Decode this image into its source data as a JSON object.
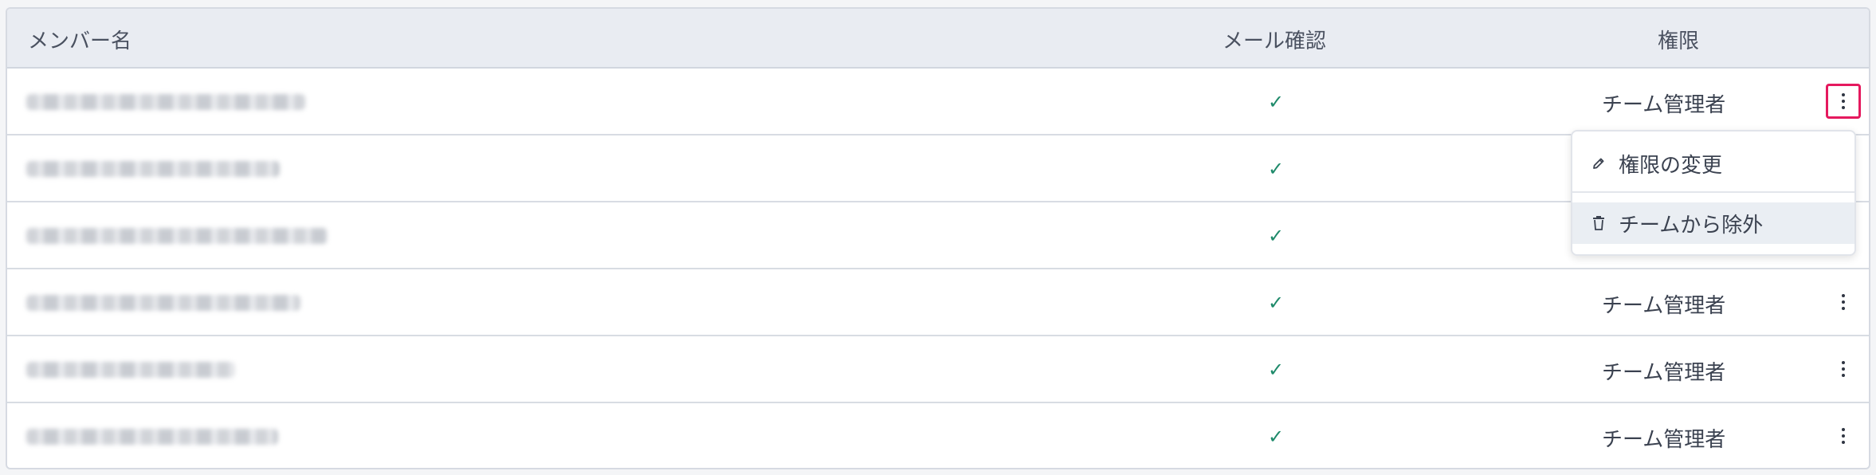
{
  "table": {
    "headers": {
      "member_name": "メンバー名",
      "email_confirmed": "メール確認",
      "permission": "権限"
    },
    "rows": [
      {
        "email_confirmed_icon": "check-icon",
        "check": "✓",
        "role": "チーム管理者",
        "menu_open": true
      },
      {
        "email_confirmed_icon": "check-icon",
        "check": "✓",
        "role": "",
        "menu_open": false
      },
      {
        "email_confirmed_icon": "check-icon",
        "check": "✓",
        "role": "",
        "menu_open": false
      },
      {
        "email_confirmed_icon": "check-icon",
        "check": "✓",
        "role": "チーム管理者",
        "menu_open": false
      },
      {
        "email_confirmed_icon": "check-icon",
        "check": "✓",
        "role": "チーム管理者",
        "menu_open": false
      },
      {
        "email_confirmed_icon": "check-icon",
        "check": "✓",
        "role": "チーム管理者",
        "menu_open": false
      }
    ]
  },
  "context_menu": {
    "items": [
      {
        "icon": "pencil-icon",
        "label": "権限の変更"
      },
      {
        "icon": "trash-icon",
        "label": "チームから除外"
      }
    ]
  },
  "colors": {
    "header_bg": "#e9ecf2",
    "check": "#1e8a6a",
    "active_outline": "#e5195e",
    "menu_hover_bg": "#eaeef3"
  }
}
